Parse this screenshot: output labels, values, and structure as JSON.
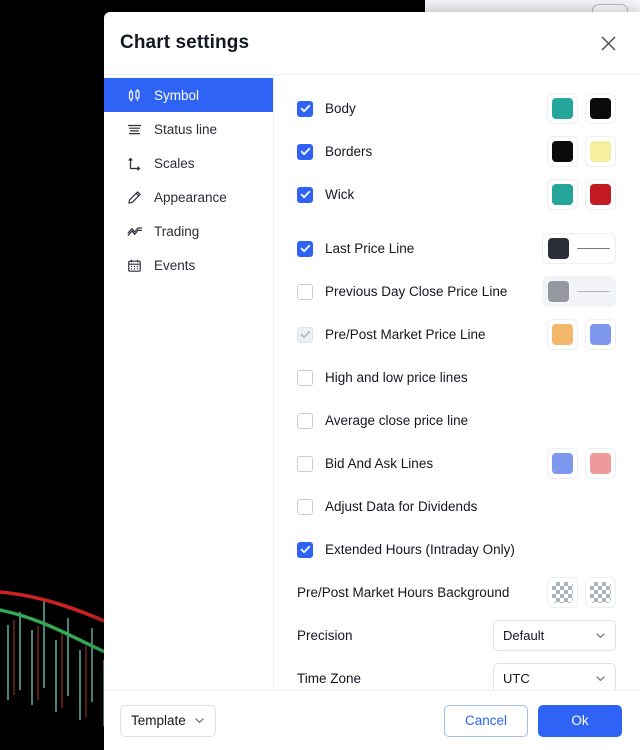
{
  "background": {
    "name": "trading-chart-backdrop",
    "bg_color": "#000000",
    "ma_line_1_color": "#cc2222",
    "ma_line_2_color": "#33aa55",
    "candle_up_color": "#26a69a",
    "candle_down_color": "#b02a37"
  },
  "dialog": {
    "title": "Chart settings",
    "close_icon": "close-icon"
  },
  "sidebar": {
    "items": [
      {
        "label": "Symbol",
        "icon": "candlestick-icon",
        "active": true
      },
      {
        "label": "Status line",
        "icon": "status-line-icon",
        "active": false
      },
      {
        "label": "Scales",
        "icon": "axes-icon",
        "active": false
      },
      {
        "label": "Appearance",
        "icon": "pencil-icon",
        "active": false
      },
      {
        "label": "Trading",
        "icon": "trend-icon",
        "active": false
      },
      {
        "label": "Events",
        "icon": "calendar-icon",
        "active": false
      }
    ]
  },
  "settings": {
    "rows": [
      {
        "label": "Body",
        "checkbox": "checked",
        "swatches": [
          "#26a69a",
          "#0b0b0b"
        ]
      },
      {
        "label": "Borders",
        "checkbox": "checked",
        "swatches": [
          "#0b0b0b",
          "#f8eea0"
        ]
      },
      {
        "label": "Wick",
        "checkbox": "checked",
        "swatches": [
          "#26a69a",
          "#c31b24"
        ]
      },
      {
        "label": "Last Price Line",
        "checkbox": "checked",
        "line_color": "#2a2e39",
        "line_width_label": "line-width-1"
      },
      {
        "label": "Previous Day Close Price Line",
        "checkbox": "unchecked",
        "line_color": "#9598a1",
        "line_width_label": "line-width-1",
        "disabled": true
      },
      {
        "label": "Pre/Post Market Price Line",
        "checkbox": "disabled-checked",
        "swatches": [
          "#f2b76a",
          "#7f98ef"
        ]
      },
      {
        "label": "High and low price lines",
        "checkbox": "unchecked"
      },
      {
        "label": "Average close price line",
        "checkbox": "unchecked"
      },
      {
        "label": "Bid And Ask Lines",
        "checkbox": "unchecked",
        "swatches": [
          "#7f98ef",
          "#ef9a9a"
        ]
      },
      {
        "label": "Adjust Data for Dividends",
        "checkbox": "unchecked"
      },
      {
        "label": "Extended Hours (Intraday Only)",
        "checkbox": "checked"
      }
    ],
    "background_row": {
      "label": "Pre/Post Market Hours Background",
      "swatch_1": "transparent-checker",
      "swatch_2": "transparent-checker"
    },
    "precision": {
      "label": "Precision",
      "value": "Default"
    },
    "timezone": {
      "label": "Time Zone",
      "value": "UTC"
    }
  },
  "footer": {
    "template_label": "Template",
    "cancel_label": "Cancel",
    "ok_label": "Ok"
  },
  "colors": {
    "accent": "#2e63f6",
    "text": "#131722",
    "muted": "#787b86"
  }
}
